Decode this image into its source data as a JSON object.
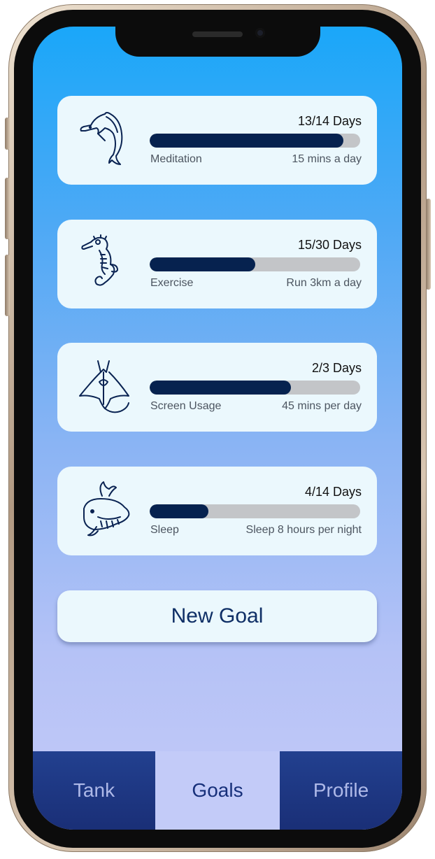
{
  "goals": [
    {
      "icon": "dolphin-icon",
      "days": "13/14 Days",
      "progress": 0.92,
      "name": "Meditation",
      "target": "15 mins a day"
    },
    {
      "icon": "seahorse-icon",
      "days": "15/30 Days",
      "progress": 0.5,
      "name": "Exercise",
      "target": "Run 3km a day"
    },
    {
      "icon": "manta-ray-icon",
      "days": "2/3 Days",
      "progress": 0.67,
      "name": "Screen Usage",
      "target": "45 mins per day"
    },
    {
      "icon": "whale-icon",
      "days": "4/14 Days",
      "progress": 0.28,
      "name": "Sleep",
      "target": "Sleep 8 hours per night"
    }
  ],
  "new_goal_label": "New Goal",
  "nav": {
    "tank": "Tank",
    "goals": "Goals",
    "profile": "Profile",
    "active": "goals"
  },
  "colors": {
    "progress_fill": "#06224f",
    "progress_track": "#c3c5c8",
    "card": "#ebf8fd",
    "nav_active": "#c3cbf8",
    "nav_bg": "#1e3a88"
  }
}
